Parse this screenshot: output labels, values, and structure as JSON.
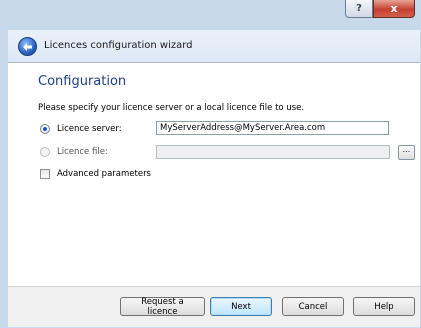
{
  "window": {
    "help_label": "?",
    "close_label": "x"
  },
  "wizard": {
    "title": "Licences configuration wizard"
  },
  "page": {
    "section_title": "Configuration",
    "instruction": "Please specify your licence server or a local licence file to use."
  },
  "options": {
    "server_label": "Licence server:",
    "server_value": "MyServerAddress@MyServer.Area.com",
    "server_selected": true,
    "file_label": "Licence file:",
    "file_value": "",
    "browse_label": "...",
    "advanced_label": "Advanced parameters",
    "advanced_checked": false
  },
  "buttons": {
    "request": "Request a licence",
    "next": "Next",
    "cancel": "Cancel",
    "help": "Help"
  },
  "colors": {
    "title_blue": "#1e3f8a",
    "accent": "#1b56c8"
  }
}
